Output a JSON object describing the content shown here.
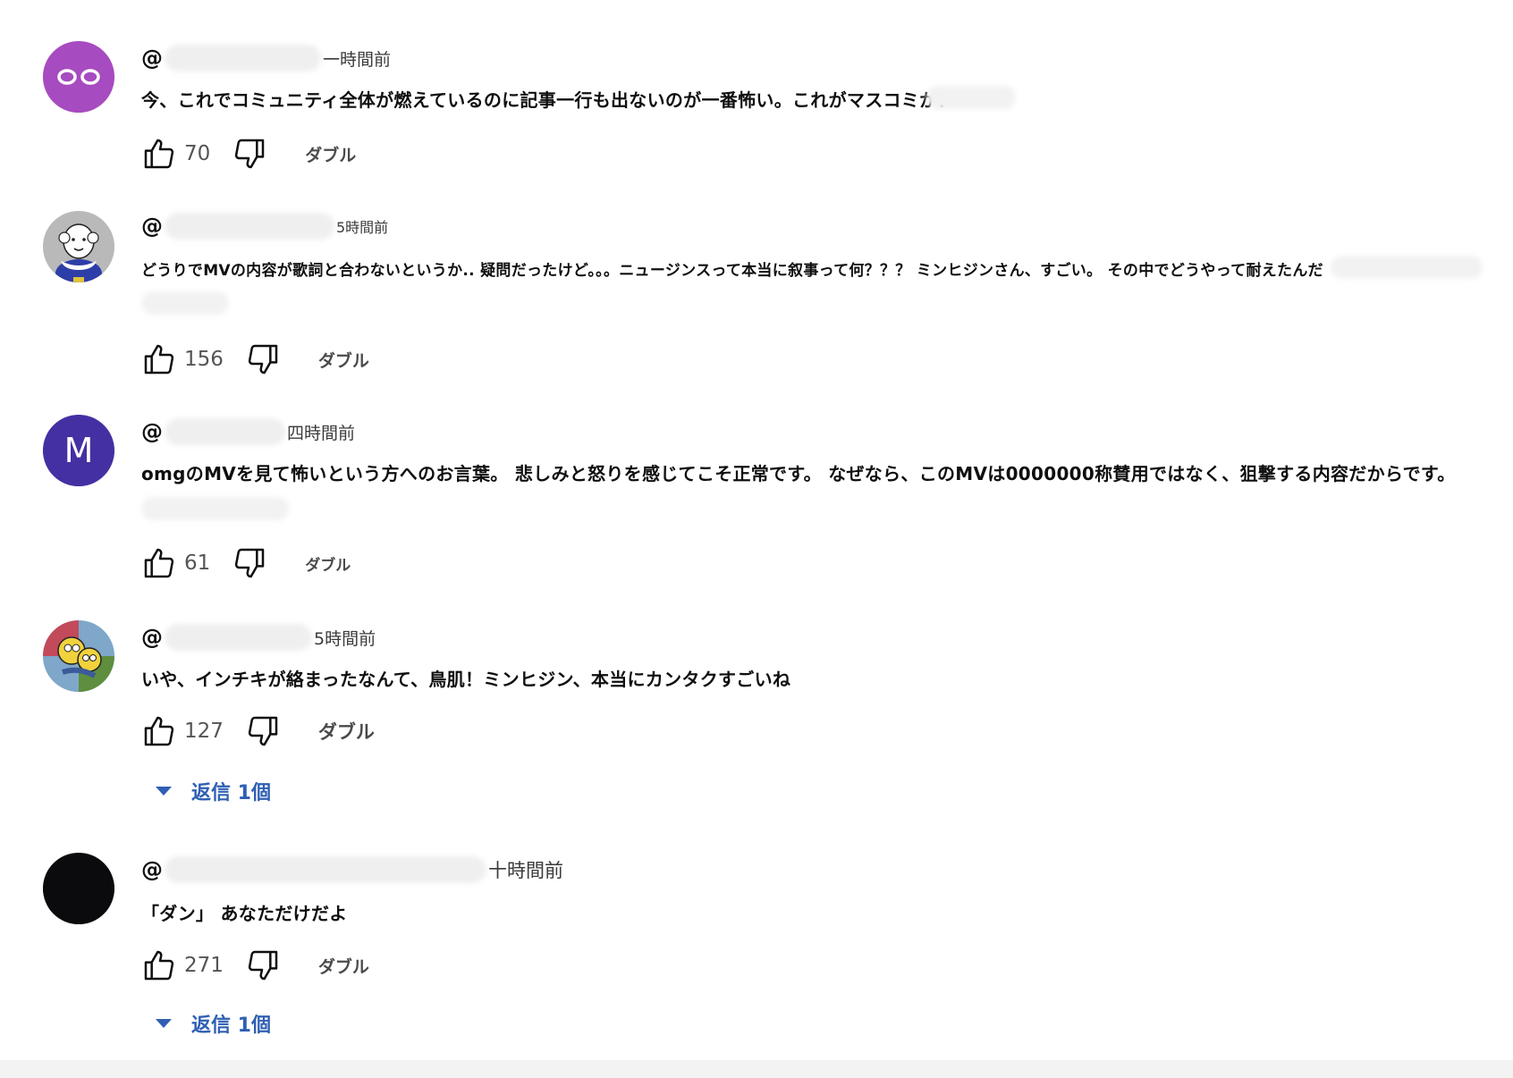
{
  "colors": {
    "text": "#0f0f0f",
    "link": "#2f5fb3",
    "avatar_purple": "#a74bc0",
    "avatar_indigo": "#4530a3",
    "avatar_black": "#0b0b0d"
  },
  "comments": [
    {
      "handle_prefix": "@",
      "time": "一時間前",
      "text": "今、これでコミュニティ全体が燃えているのに記事一行も出ないのが一番怖い。これがマスコミか？",
      "likes": "70",
      "dub_label": "ダブル",
      "avatar_icon": "eyes-avatar-icon"
    },
    {
      "handle_prefix": "@",
      "time": "5時間前",
      "text": "どうりでMVの内容が歌詞と合わないというか.. 疑問だったけど。。。ニュージンスって本当に叙事って何？？？ ミンヒジンさん、すごい。 その中でどうやって耐えたんだ",
      "likes": "156",
      "dub_label": "ダブル",
      "avatar_icon": "cartoon-old-man-avatar-icon"
    },
    {
      "handle_prefix": "@",
      "time": "四時間前",
      "text": "omgのMVを見て怖いという方へのお言葉。 悲しみと怒りを感じてこそ正常です。 なぜなら、このMVは0000000称賛用ではなく、狙撃する内容だからです。",
      "likes": "61",
      "dub_label": "ダブル",
      "avatar_letter": "M",
      "avatar_icon": "letter-avatar-icon"
    },
    {
      "handle_prefix": "@",
      "time": "5時間前",
      "text": "いや、インチキが絡まったなんて、鳥肌！ミンヒジン、本当にカンタクすごいね",
      "likes": "127",
      "dub_label": "ダブル",
      "replies": "返信 1個",
      "avatar_icon": "cartoon-avatar-icon"
    },
    {
      "handle_prefix": "@",
      "time": "十時間前",
      "text": "「ダン」 あなただけだよ",
      "likes": "271",
      "dub_label": "ダブル",
      "replies": "返信 1個",
      "avatar_icon": "black-avatar-icon"
    }
  ]
}
